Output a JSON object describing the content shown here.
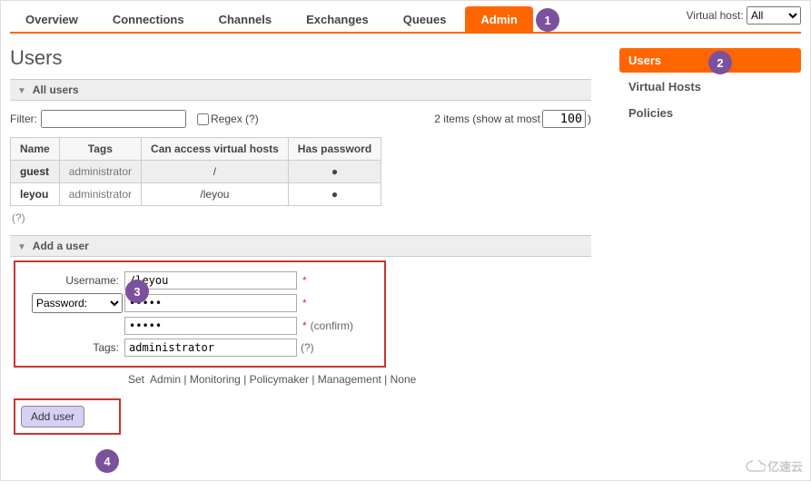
{
  "nav": {
    "tabs": [
      "Overview",
      "Connections",
      "Channels",
      "Exchanges",
      "Queues",
      "Admin"
    ],
    "active": 5,
    "vhost_label": "Virtual host:",
    "vhost_value": "All"
  },
  "markers": {
    "m1": "1",
    "m2": "2",
    "m3": "3",
    "m4": "4"
  },
  "sidemenu": {
    "items": [
      "Users",
      "Virtual Hosts",
      "Policies"
    ],
    "active": 0
  },
  "page_title": "Users",
  "section": {
    "all_users": "All users",
    "add_user": "Add a user"
  },
  "filter": {
    "label": "Filter:",
    "value": "",
    "regex_label": "Regex (?)",
    "items_prefix": "2 items (show at most",
    "items_value": "100",
    "items_suffix": ")"
  },
  "users_table": {
    "headers": [
      "Name",
      "Tags",
      "Can access virtual hosts",
      "Has password"
    ],
    "rows": [
      {
        "name": "guest",
        "tags": "administrator",
        "vhosts": "/",
        "has_pw": "●"
      },
      {
        "name": "leyou",
        "tags": "administrator",
        "vhosts": "/leyou",
        "has_pw": "●"
      }
    ]
  },
  "help_q": "(?)",
  "form": {
    "username_label": "Username:",
    "username_value": "/leyou",
    "password_label": "Password:",
    "password_value": "•••••",
    "password_confirm_value": "•••••",
    "confirm_text": "(confirm)",
    "tags_label": "Tags:",
    "tags_value": "administrator",
    "tags_q": "(?)",
    "set_prefix": "Set",
    "set_links": "Admin | Monitoring | Policymaker | Management | None",
    "add_button": "Add user"
  },
  "watermark": "亿速云"
}
